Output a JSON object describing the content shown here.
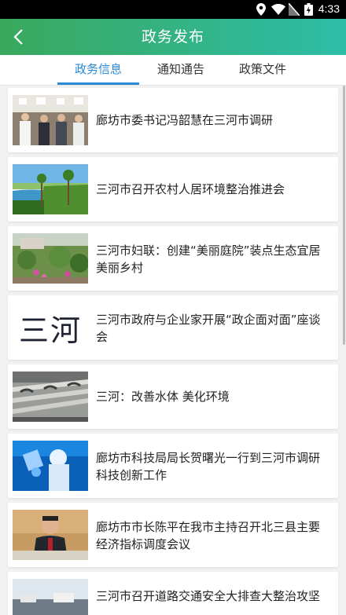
{
  "status_bar": {
    "time": "4:33"
  },
  "app_bar": {
    "title": "政务发布"
  },
  "tabs": [
    {
      "label": "政务信息"
    },
    {
      "label": "通知通告"
    },
    {
      "label": "政策文件"
    }
  ],
  "news": [
    {
      "title": "廊坊市委书记冯韶慧在三河市调研"
    },
    {
      "title": "三河市召开农村人居环境整治推进会"
    },
    {
      "title": "三河市妇联：创建“美丽庭院”装点生态宜居美丽乡村"
    },
    {
      "title": "三河市政府与企业家开展“政企面对面”座谈会",
      "thumb_text": "三河"
    },
    {
      "title": "三河：改善水体 美化环境"
    },
    {
      "title": "廊坊市科技局局长贺曙光一行到三河市调研科技创新工作"
    },
    {
      "title": "廊坊市市长陈平在我市主持召开北三县主要经济指标调度会议"
    },
    {
      "title": "三河市召开道路交通安全大排查大整治攻坚"
    }
  ]
}
